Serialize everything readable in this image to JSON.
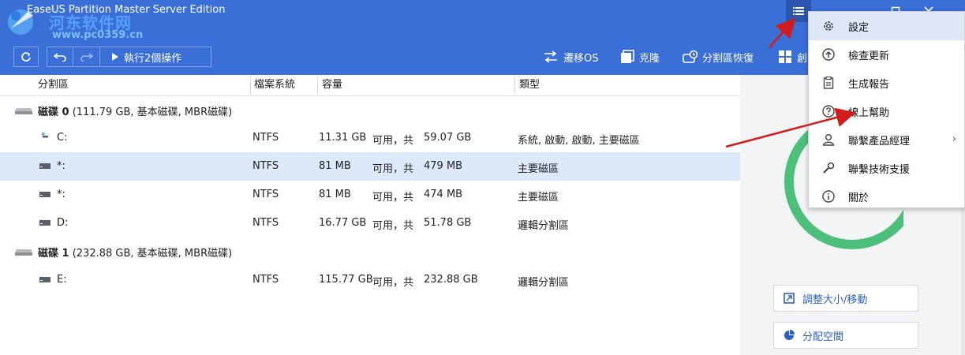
{
  "app": {
    "title": "EaseUS Partition Master Server Edition",
    "watermark_text": "河东软件网",
    "watermark_url": "www.pc0359.cn"
  },
  "toolbar": {
    "execute_label": "執行2個操作",
    "actions": [
      {
        "name": "migrate-os",
        "label": "遷移OS",
        "icon": "migrate-icon"
      },
      {
        "name": "clone",
        "label": "克隆",
        "icon": "clone-icon"
      },
      {
        "name": "partition-recovery",
        "label": "分割區恢復",
        "icon": "recovery-icon"
      },
      {
        "name": "windows",
        "label": "創",
        "icon": "windows-icon"
      }
    ]
  },
  "table": {
    "headers": [
      "分割區",
      "檔案系統",
      "容量",
      "類型"
    ],
    "disks": [
      {
        "label": "磁碟 0",
        "detail": "(111.79 GB, 基本磁碟, MBR磁碟)",
        "partitions": [
          {
            "name": "C:",
            "fs": "NTFS",
            "free": "11.31 GB",
            "mid": "可用，共",
            "total": "59.07 GB",
            "type": "系統, 啟動, 啟動, 主要磁區",
            "selected": false,
            "icon": "windows-drive-icon"
          },
          {
            "name": "*:",
            "fs": "NTFS",
            "free": "81 MB",
            "mid": "可用，共",
            "total": "479 MB",
            "type": "主要磁區",
            "selected": true,
            "icon": "drive-icon"
          },
          {
            "name": "*:",
            "fs": "NTFS",
            "free": "81 MB",
            "mid": "可用，共",
            "total": "474 MB",
            "type": "主要磁區",
            "selected": false,
            "icon": "drive-icon"
          },
          {
            "name": "D:",
            "fs": "NTFS",
            "free": "16.77 GB",
            "mid": "可用，共",
            "total": "51.78 GB",
            "type": "邏輯分割區",
            "selected": false,
            "icon": "drive-icon"
          }
        ]
      },
      {
        "label": "磁碟 1",
        "detail": "(232.88 GB, 基本磁碟, MBR磁碟)",
        "partitions": [
          {
            "name": "E:",
            "fs": "NTFS",
            "free": "115.77 GB",
            "mid": "可用，共",
            "total": "232.88 GB",
            "type": "邏輯分割區",
            "selected": false,
            "icon": "drive-icon"
          }
        ]
      }
    ]
  },
  "sidebar": {
    "buttons": [
      {
        "label": "調整大小/移動",
        "icon": "resize-icon"
      },
      {
        "label": "分配空間",
        "icon": "pie-icon"
      }
    ]
  },
  "menu": {
    "items": [
      {
        "label": "設定",
        "icon": "gear-icon",
        "hover": true
      },
      {
        "label": "檢查更新",
        "icon": "upload-icon"
      },
      {
        "label": "生成報告",
        "icon": "report-icon"
      },
      {
        "label": "線上幫助",
        "icon": "help-icon"
      },
      {
        "label": "聯繫產品經理",
        "icon": "person-icon",
        "submenu": true
      },
      {
        "label": "聯繫技術支援",
        "icon": "wrench-icon"
      },
      {
        "label": "關於",
        "icon": "info-icon"
      }
    ]
  },
  "colors": {
    "titlebar": "#3a6fd8",
    "selected_row": "#dce9fb",
    "accent": "#2b5fc7",
    "donut": "#4cc07a",
    "arrow": "#d21b1b"
  }
}
